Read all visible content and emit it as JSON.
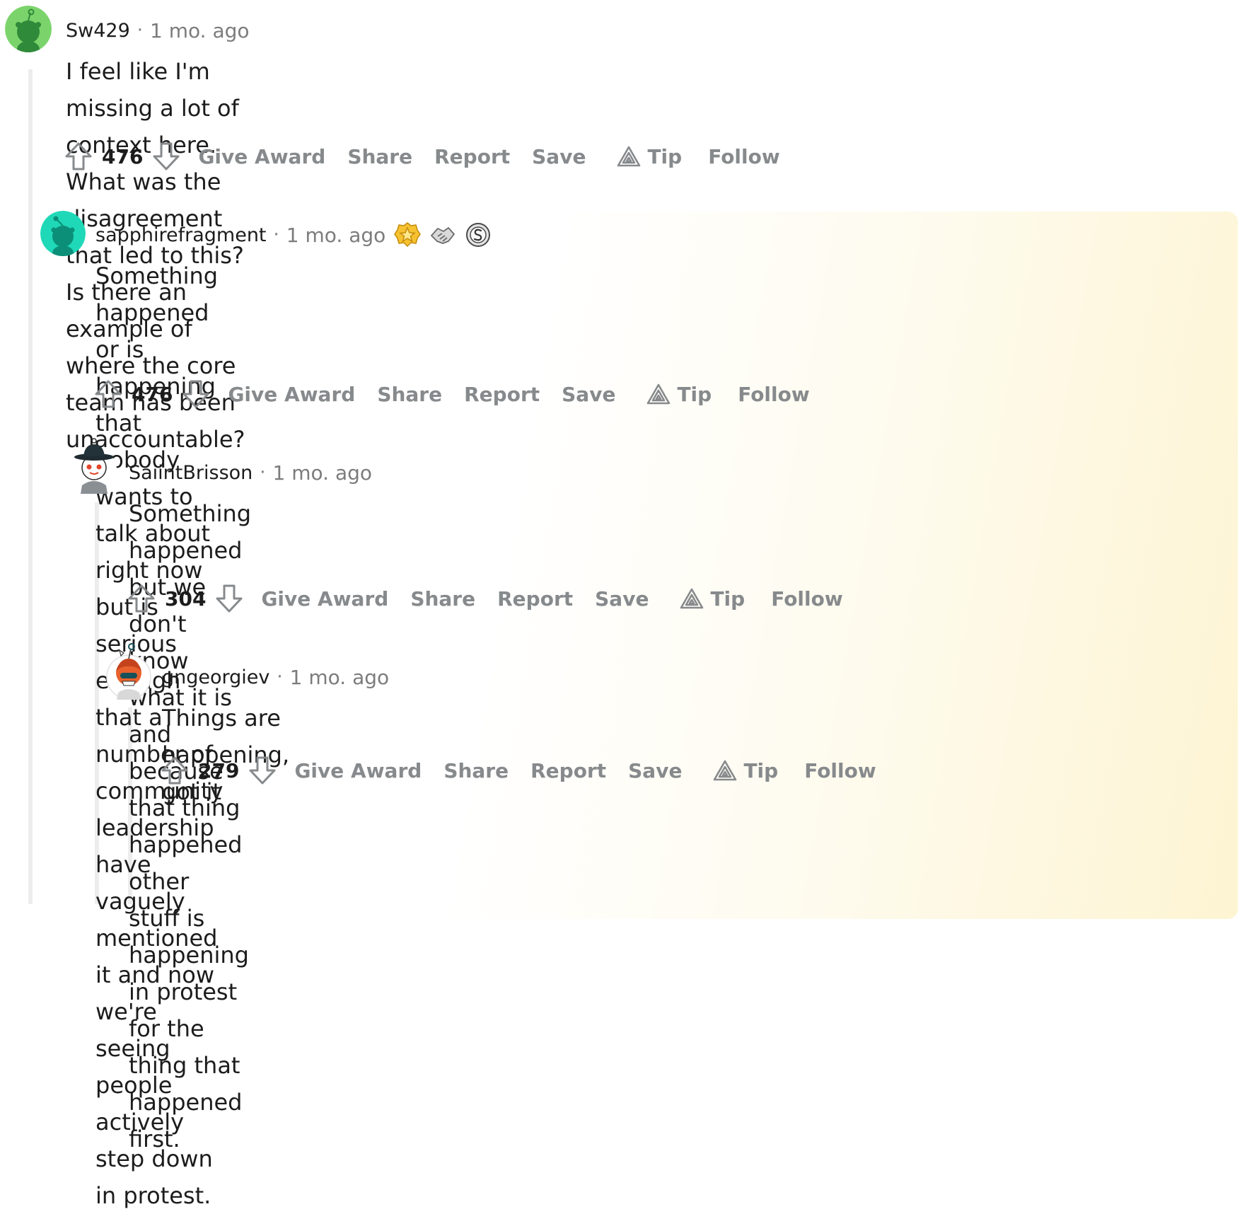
{
  "comments": [
    {
      "author": "Sw429",
      "separator": "·",
      "time": "1 mo. ago",
      "body_lines": [
        "I feel like I'm missing a lot of context here. What was the disagreement that led to this? Is there an",
        "example of where the core team has been unaccountable?"
      ],
      "score": "476",
      "avatar_color": "#7bd46b"
    },
    {
      "author": "sapphirefragment",
      "separator": "·",
      "time": "1 mo. ago",
      "awards": [
        "gold-star-award-icon",
        "handshake-award-icon",
        "silver-award-icon"
      ],
      "body_lines": [
        "Something happened or is happening that nobody wants to talk about right now but is serious",
        "enough that a number of community leadership have vaguely mentioned it and now we're",
        "seeing people actively step down in protest."
      ],
      "score": "476",
      "avatar_color": "#1fd8b7"
    },
    {
      "author": "SaiintBrisson",
      "separator": "·",
      "time": "1 mo. ago",
      "body_lines": [
        "Something happened but we don't know what it is and because that thing happened other",
        "stuff is happening in protest for the thing that happened first."
      ],
      "score": "304",
      "avatar_color": "#ffffff"
    },
    {
      "author": "gngeorgiev",
      "separator": "·",
      "time": "1 mo. ago",
      "body_lines": [
        "Things are happening, got it"
      ],
      "score": "279",
      "avatar_color": "#e8612c"
    }
  ],
  "actions": {
    "give_award": "Give Award",
    "share": "Share",
    "report": "Report",
    "save": "Save",
    "tip": "Tip",
    "follow": "Follow"
  },
  "colors": {
    "action_gray": "#878a8c",
    "time_gray": "#7c7c7c",
    "thread_line": "#ededed",
    "highlight": "#fdf4d2"
  }
}
